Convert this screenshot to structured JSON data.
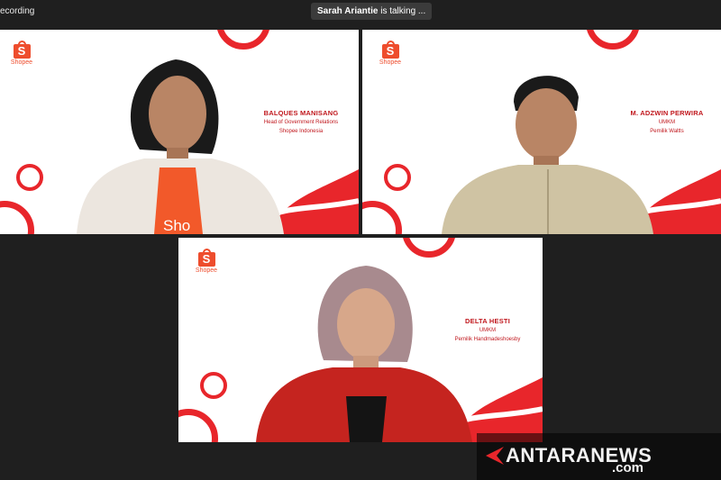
{
  "status": {
    "recording_label": "ecording"
  },
  "speaker": {
    "name": "Sarah Ariantie",
    "suffix": "is talking ..."
  },
  "brand": {
    "logo_text": "Shopee",
    "bag_letter": "S",
    "color": "#ee4d2d",
    "accent": "#e8262b"
  },
  "participants": [
    {
      "name": "BALQUES MANISANG",
      "role_line1": "Head of Government Relations",
      "role_line2": "Shopee Indonesia",
      "shirt_text": "Sho"
    },
    {
      "name": "M. ADZWIN PERWIRA",
      "role_line1": "UMKM",
      "role_line2": "Pemilik Waltts"
    },
    {
      "name": "DELTA HESTI",
      "role_line1": "UMKM",
      "role_line2": "Pemilik Handmadeshoesby"
    }
  ],
  "watermark": {
    "main": "ANTARANEWS",
    "suffix": ".com"
  }
}
